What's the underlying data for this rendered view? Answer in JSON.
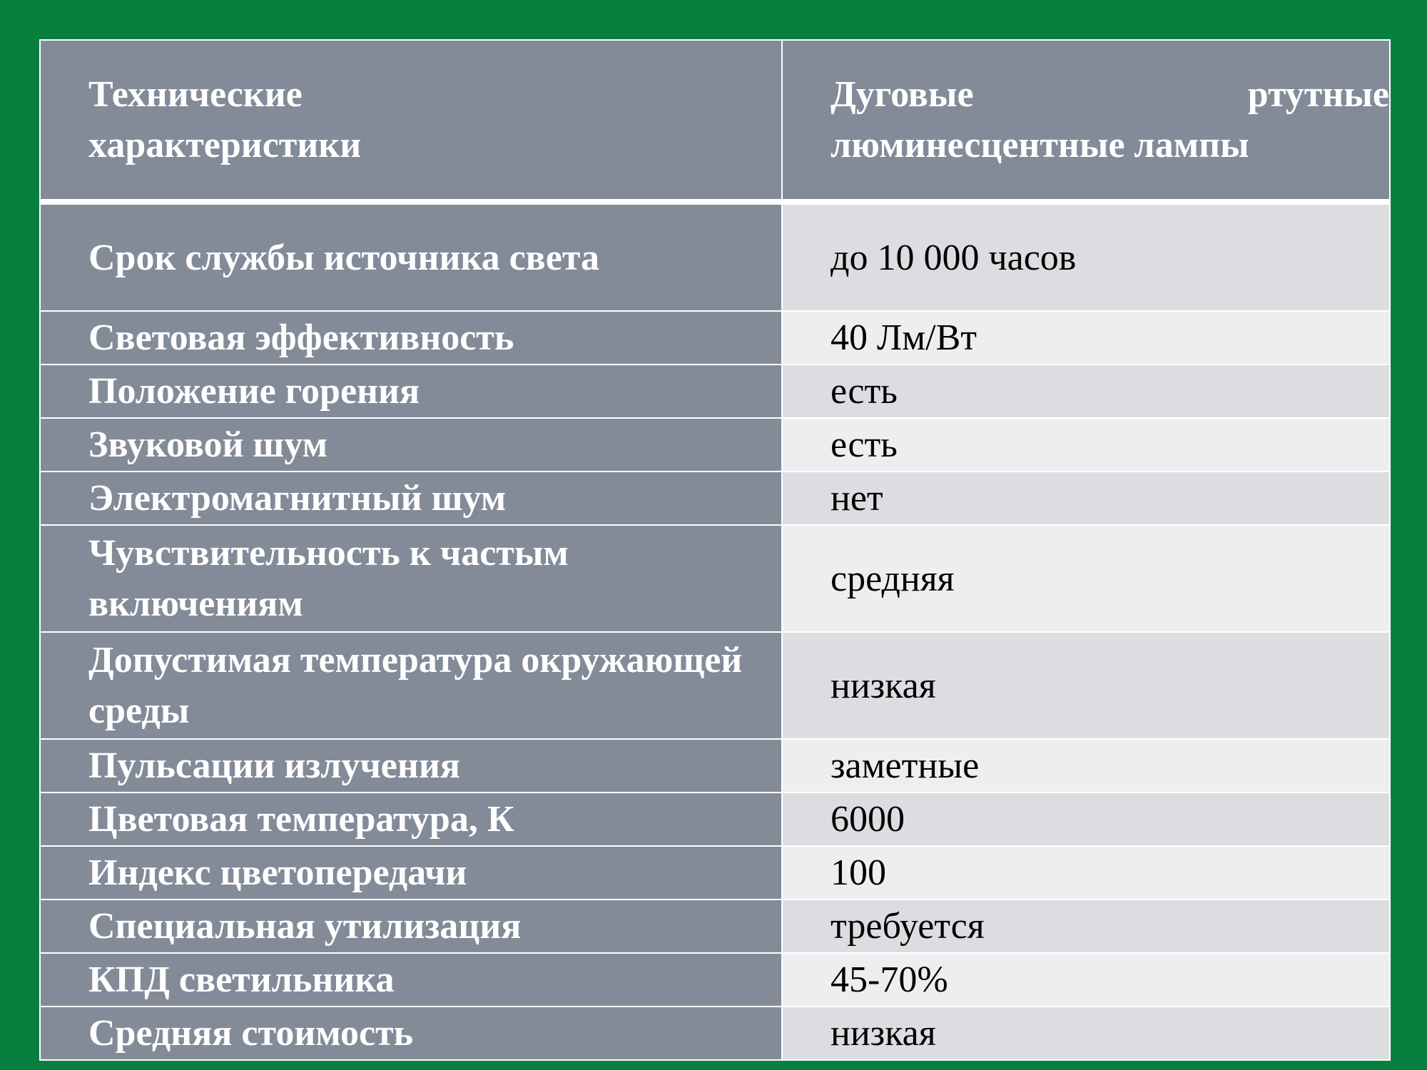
{
  "header": {
    "col1_line1": "Технические",
    "col1_line2": "характеристики",
    "col2_word1": "Дуговые",
    "col2_word2": "ртутные",
    "col2_line2": "люминесцентные лампы"
  },
  "rows": [
    {
      "label": "Срок службы источника света",
      "value": "до 10 000 часов"
    },
    {
      "label": "Световая эффективность",
      "value": "40 Лм/Вт"
    },
    {
      "label": "Положение горения",
      "value": "есть"
    },
    {
      "label": "Звуковой шум",
      "value": "есть"
    },
    {
      "label": "Электромагнитный шум",
      "value": "нет"
    },
    {
      "label": "Чувствительность к частым включениям",
      "value": "средняя"
    },
    {
      "label": "Допустимая температура окружающей среды",
      "value": "низкая"
    },
    {
      "label": "Пульсации излучения",
      "value": "заметные"
    },
    {
      "label": "Цветовая температура, К",
      "value": "6000"
    },
    {
      "label": "Индекс цветопередачи",
      "value": "100"
    },
    {
      "label": "Специальная утилизация",
      "value": "требуется"
    },
    {
      "label": "КПД светильника",
      "value": "45-70%"
    },
    {
      "label": "Средняя стоимость",
      "value": "низкая"
    }
  ]
}
